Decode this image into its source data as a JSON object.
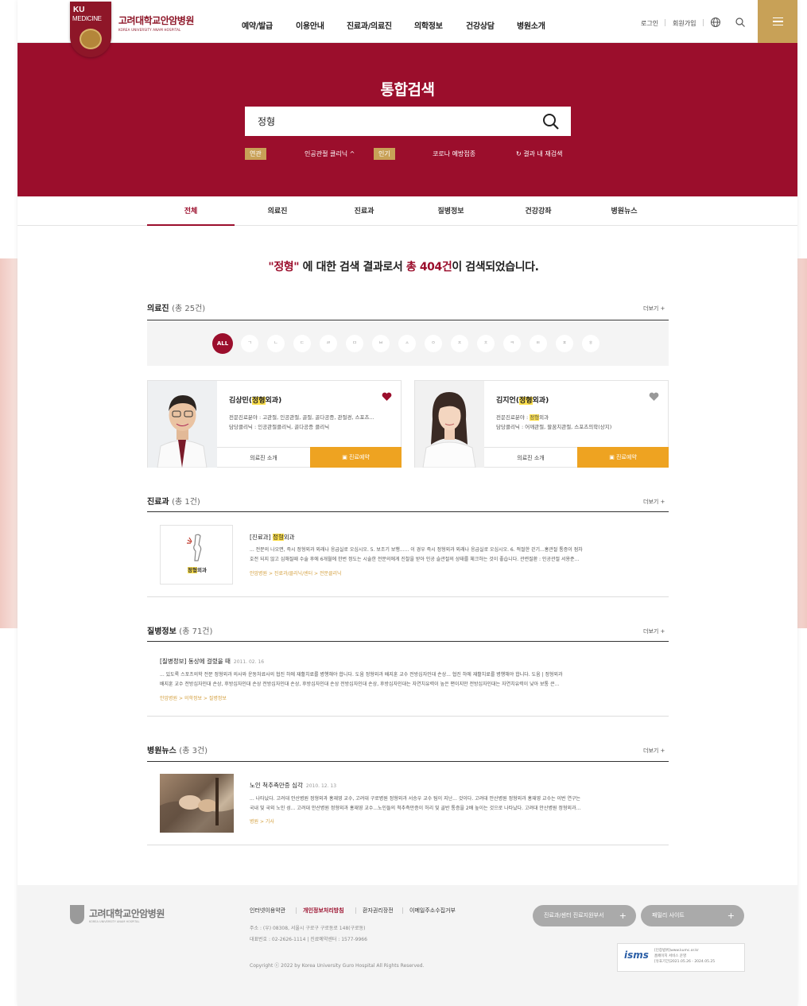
{
  "header": {
    "logo_ku": "KU",
    "logo_medicine": "MEDICINE",
    "hospital_name": "고려대학교안암병원",
    "hospital_name_en": "KOREA UNIVERSITY ANAM HOSPITAL",
    "nav": [
      "예약/발급",
      "이용안내",
      "진료과/의료진",
      "의학정보",
      "건강상담",
      "병원소개"
    ],
    "login": "로그인",
    "signup": "회원가입",
    "icons": [
      "globe-icon",
      "search-icon",
      "hamburger-menu-icon"
    ]
  },
  "search": {
    "title": "통합검색",
    "query": "정형",
    "tag_related": "연관",
    "related_value": "인공관절 클리닉",
    "tag_popular": "인기",
    "popular_value": "코로나 예방접종",
    "research_label": "결과 내 재검색"
  },
  "tabs": [
    "전체",
    "의료진",
    "진료과",
    "질병정보",
    "건강강좌",
    "병원뉴스"
  ],
  "summary": {
    "query_quoted": "\"정형\"",
    "mid": " 에 대한 검색 결과로서 ",
    "total": "총 404건",
    "tail": "이 검색되었습니다."
  },
  "more_label": "더보기 +",
  "doctors_section": {
    "title": "의료진",
    "count": "(총 25건)",
    "initials": [
      "ALL",
      "ㄱ",
      "ㄴ",
      "ㄷ",
      "ㄹ",
      "ㅁ",
      "ㅂ",
      "ㅅ",
      "ㅇ",
      "ㅈ",
      "ㅊ",
      "ㅋ",
      "ㅌ",
      "ㅍ",
      "ㅎ"
    ],
    "doctors": [
      {
        "name_pre": "김상민(",
        "name_hl": "정형",
        "name_post": "외과)",
        "spec_line1": "전문진료분야 : 고관절, 인공관절, 골절, 골다공증, 관절경, 스포츠...",
        "spec_line2": "담당클리닉 : 인공관절클리닉, 골다공증 클리닉",
        "intro": "의료진 소개",
        "reserve": "진료예약",
        "favorite": true
      },
      {
        "name_pre": "김지언(",
        "name_hl": "정형",
        "name_post": "외과)",
        "spec_line1_pre": "전문진료분야 : ",
        "spec_line1_hl": "정형",
        "spec_line1_post": "외과",
        "spec_line2": "담당클리닉 : 어깨관절, 팔꿈치관절, 스포츠의학(상지)",
        "intro": "의료진 소개",
        "reserve": "진료예약",
        "favorite": false
      }
    ]
  },
  "dept_section": {
    "title": "진료과",
    "count": "(총 1건)",
    "box_label_hl": "정형",
    "box_label_post": "외과",
    "item_title_pre": "[진료과] ",
    "item_title_hl": "정형",
    "item_title_post": "외과",
    "body_line1": "... 전문의 나오면, 즉시 정형외과 외래나 응급실로 오십시오. 5. 보조기 보행...... 이 경우 즉시 정형외과 외래나 응급실로 오십시오. 6. 적절한 걷기...홍관절 통증이 점차",
    "body_line2": "호전 되지 않고 심해질때 수술 후에 6개월에 한번 정도는 시술한 전문의에게 진찰을 받아 인공 슬관절의 상태를 체크하는 것이 좋습니다. 관련질환 : 인공관절 서용준...",
    "path": "안암병원 > 진료과/클리닉/센터 > 전문클리닉"
  },
  "disease_section": {
    "title": "질병정보",
    "count": "(총 71건)",
    "item_title": "[질병정보] 동상에 걸렸을 때",
    "item_date": "2011. 02. 16",
    "body_line1": "... 있도록 스포츠의학 전문 정형외과 의사와 운동처료사의 협진 하에 재활치료를 병행해야 합니다. 도움 정형외과 배지훈 교수 전방십자인대 손상... 협진 하에 재활치료를 병행해야 합니다. 도움 | 정형외과",
    "body_line2": "배지훈 교수 전방십자인대 손상, 후방십자인대 손상 전방십자인대 손상, 후방십자인대 손상 전방십자인대 손상, 후방십자인대는 자연치유력이 높은 편이지만 전방십자인대는 자연치유력이 낮아 보통 큰...",
    "path": "안암병원 > 의학정보 > 질병정보"
  },
  "news_section": {
    "title": "병원뉴스",
    "count": "(총 3건)",
    "item_title": "노인 척추측만증 심각",
    "item_date": "2010. 12. 13",
    "body_line1": "... 나타났다. 고려대 안산병원 정형외과 홍재영 교수, 고려대 구로병원 정형외과 서승우 교수 팀이 지난... 것이다. 고려대 안산병원 정형외과 홍재영 교수는 이번 연구는",
    "body_line2": "국내 및 국외 노인 성... 고려대 안산병원 정형외과 홍재영 교수...노인들의 척추측만증이 허리 및 골반 통증을 2배 높이는 것으로 나타났다. 고려대 안산병원 정형외과...",
    "path": "병원 > 기사"
  },
  "footer": {
    "hospital_name": "고려대학교안암병원",
    "hospital_name_en": "KOREA UNIVERSITY ANAM HOSPITAL",
    "links": [
      "인터넷이용약관",
      "개인정보처리방침",
      "환자권리장전",
      "이메일주소수집거부"
    ],
    "address": "주소 : (우) 08308, 서울시 구로구 구로동로 148(구로동)",
    "phone": "대표번호 : 02-2626-1114   |   진료예약센터 : 1577-9966",
    "copyright": "Copyright ⓒ 2022 by Korea University Guro Hospital All Rights Reserved.",
    "btn_support": "진료과/센터 진료지원부서",
    "btn_family": "패밀리 사이트",
    "isms_mark": "isms",
    "isms_line1": "[인증범위]www.kumc.or.kr",
    "isms_line2": "홈페이지 서비스 운영",
    "isms_line3": "[유효기간]2021.05.26 - 2024.05.25"
  },
  "colors": {
    "brand": "#9b0e2c",
    "gold": "#c8a157",
    "reserve": "#eea321",
    "highlight": "#ffe14d"
  }
}
